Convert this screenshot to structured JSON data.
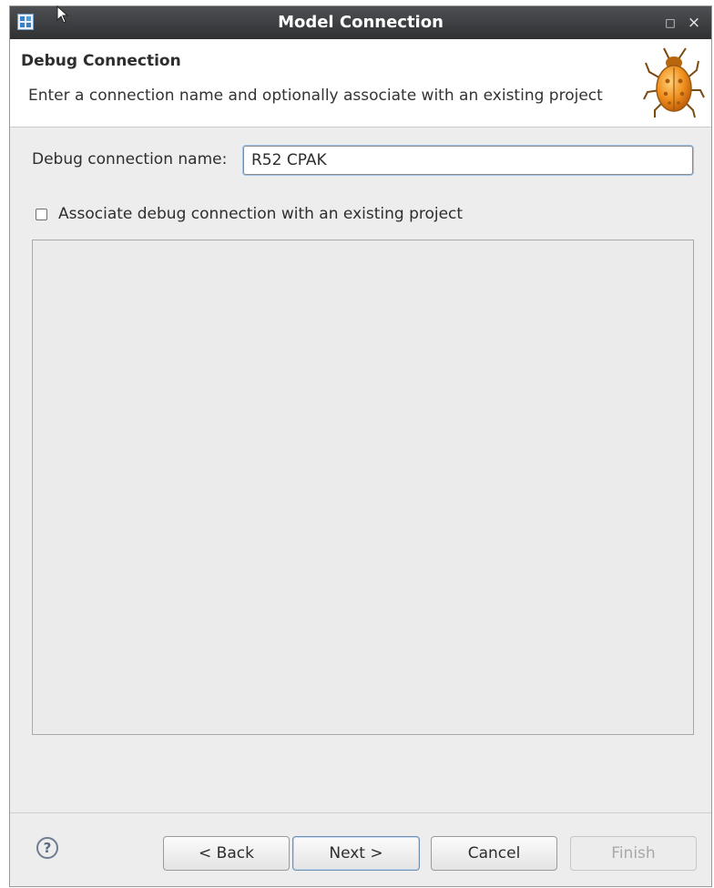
{
  "window": {
    "title": "Model Connection",
    "maximize_glyph": "□",
    "close_glyph": "×"
  },
  "banner": {
    "title": "Debug Connection",
    "description": "Enter a connection name and optionally associate with an existing project",
    "icon": "bug-icon"
  },
  "form": {
    "name_label": "Debug connection name:",
    "name_value": "R52 CPAK",
    "associate_label": "Associate debug connection with an existing project",
    "associate_checked": false
  },
  "buttons": {
    "help": "?",
    "back": "< Back",
    "next": "Next >",
    "cancel": "Cancel",
    "finish": "Finish"
  },
  "colors": {
    "titlebar": "#3a3c3e",
    "dialog_bg": "#ededed",
    "focus": "#9fc2e6"
  }
}
